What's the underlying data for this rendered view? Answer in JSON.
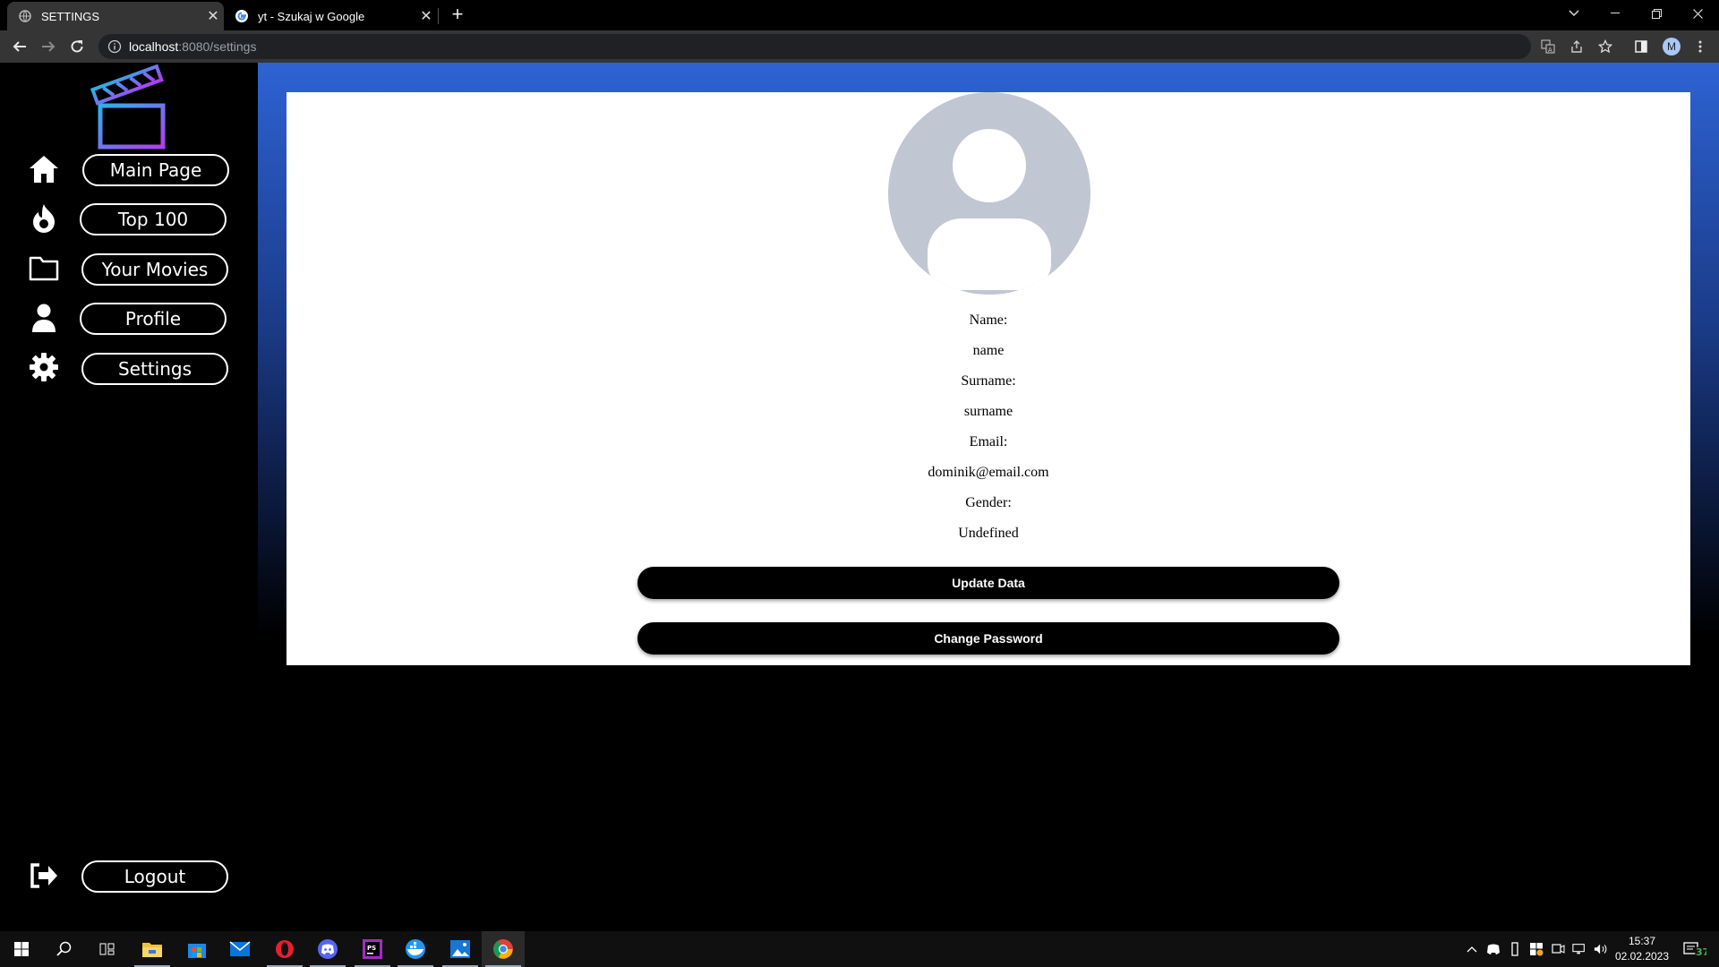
{
  "browser": {
    "tabs": [
      {
        "title": "SETTINGS",
        "active": true
      },
      {
        "title": "yt - Szukaj w Google",
        "active": false
      }
    ],
    "url_host": "localhost",
    "url_path": ":8080/settings",
    "profile_initial": "M"
  },
  "sidebar": {
    "items": [
      {
        "label": "Main Page",
        "icon": "home-icon"
      },
      {
        "label": "Top 100",
        "icon": "fire-icon"
      },
      {
        "label": "Your Movies",
        "icon": "folder-icon"
      },
      {
        "label": "Profile",
        "icon": "user-icon"
      },
      {
        "label": "Settings",
        "icon": "gear-icon"
      }
    ],
    "logout": {
      "label": "Logout",
      "icon": "logout-icon"
    }
  },
  "profile": {
    "fields": [
      {
        "label": "Name:",
        "value": "name"
      },
      {
        "label": "Surname:",
        "value": "surname"
      },
      {
        "label": "Email:",
        "value": "dominik@email.com"
      },
      {
        "label": "Gender:",
        "value": "Undefined"
      }
    ],
    "update_button": "Update Data",
    "password_button": "Change Password"
  },
  "taskbar": {
    "time": "15:37",
    "date": "02.02.2023"
  },
  "colors": {
    "accent_blue": "#2e63d4",
    "avatar_gray": "#c0c6d2",
    "chrome_dark": "#353535"
  }
}
